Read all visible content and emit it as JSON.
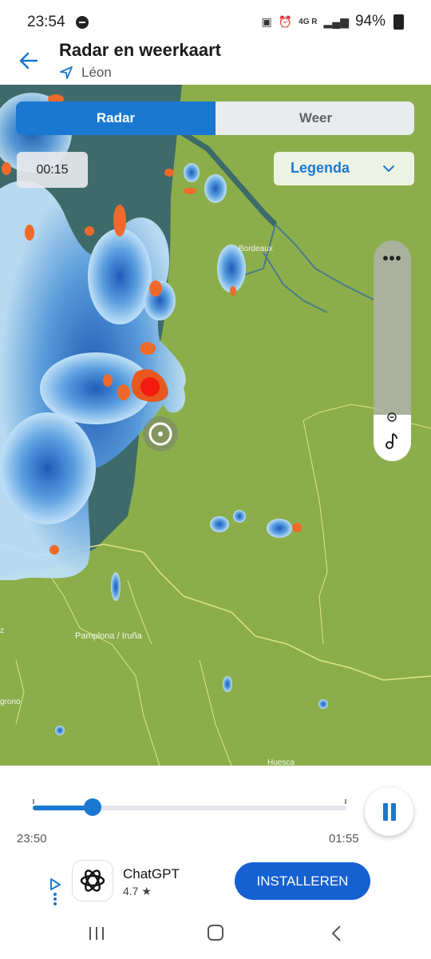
{
  "status": {
    "time": "23:54",
    "network": "4G R",
    "battery": "94%"
  },
  "header": {
    "title": "Radar en weerkaart",
    "location": "Léon",
    "back_icon": "arrow-left-icon",
    "location_icon": "navigation-arrow-icon"
  },
  "tabs": [
    {
      "label": "Radar",
      "active": true
    },
    {
      "label": "Weer",
      "active": false
    }
  ],
  "map": {
    "time_chip": "00:15",
    "legend_label": "Legenda",
    "place_labels": {
      "bordeaux": "Bordeaux",
      "pamplona": "Pamplona / Iruña",
      "logrono": "grono",
      "huesca": "Huesca",
      "edge_z": "z"
    }
  },
  "layer_control": {
    "more_icon": "•••",
    "minus_icon": "minus-circle-icon",
    "music_icon": "music-note-icon"
  },
  "player": {
    "start_time": "23:50",
    "end_time": "01:55",
    "progress": 0.19,
    "state": "playing"
  },
  "ad": {
    "app_name": "ChatGPT",
    "rating": "4.7 ★",
    "install_label": "INSTALLEREN"
  },
  "colors": {
    "accent": "#1a78d0",
    "install": "#1561d2",
    "land": "#8bae4b",
    "sea": "#3e6a6a"
  }
}
